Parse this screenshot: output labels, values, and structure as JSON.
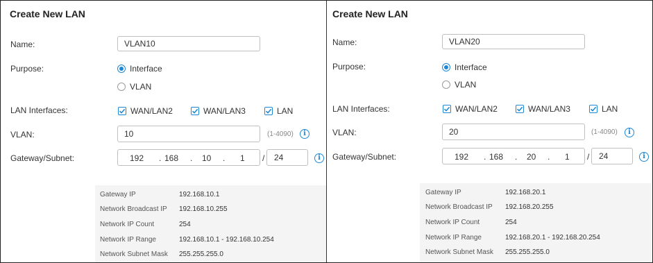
{
  "panels": [
    {
      "title": "Create New LAN",
      "labels": {
        "name": "Name:",
        "purpose": "Purpose:",
        "lan_interfaces": "LAN Interfaces:",
        "vlan": "VLAN:",
        "gateway": "Gateway/Subnet:"
      },
      "name_value": "VLAN10",
      "purpose_options": [
        "Interface",
        "VLAN"
      ],
      "purpose_selected": "Interface",
      "lan_interfaces": [
        {
          "label": "WAN/LAN2",
          "checked": true
        },
        {
          "label": "WAN/LAN3",
          "checked": true
        },
        {
          "label": "LAN",
          "checked": true
        }
      ],
      "vlan_value": "10",
      "vlan_range": "(1-4090)",
      "gateway_octets": [
        "192",
        "168",
        "10",
        "1"
      ],
      "subnet_mask_bits": "24",
      "summary": [
        {
          "key": "Gateway IP",
          "value": "192.168.10.1"
        },
        {
          "key": "Network Broadcast IP",
          "value": "192.168.10.255"
        },
        {
          "key": "Network IP Count",
          "value": "254"
        },
        {
          "key": "Network IP Range",
          "value": "192.168.10.1 - 192.168.10.254"
        },
        {
          "key": "Network Subnet Mask",
          "value": "255.255.255.0"
        }
      ]
    },
    {
      "title": "Create New LAN",
      "labels": {
        "name": "Name:",
        "purpose": "Purpose:",
        "lan_interfaces": "LAN Interfaces:",
        "vlan": "VLAN:",
        "gateway": "Gateway/Subnet:"
      },
      "name_value": "VLAN20",
      "purpose_options": [
        "Interface",
        "VLAN"
      ],
      "purpose_selected": "Interface",
      "lan_interfaces": [
        {
          "label": "WAN/LAN2",
          "checked": true
        },
        {
          "label": "WAN/LAN3",
          "checked": true
        },
        {
          "label": "LAN",
          "checked": true
        }
      ],
      "vlan_value": "20",
      "vlan_range": "(1-4090)",
      "gateway_octets": [
        "192",
        "168",
        "20",
        "1"
      ],
      "subnet_mask_bits": "24",
      "summary": [
        {
          "key": "Gateway IP",
          "value": "192.168.20.1"
        },
        {
          "key": "Network Broadcast IP",
          "value": "192.168.20.255"
        },
        {
          "key": "Network IP Count",
          "value": "254"
        },
        {
          "key": "Network IP Range",
          "value": "192.168.20.1 - 192.168.20.254"
        },
        {
          "key": "Network Subnet Mask",
          "value": "255.255.255.0"
        }
      ]
    }
  ],
  "colors": {
    "accent": "#1e88d6",
    "summary_bg": "#f4f4f4"
  },
  "icons": {
    "info": "info-icon",
    "check": "checkmark-icon"
  }
}
